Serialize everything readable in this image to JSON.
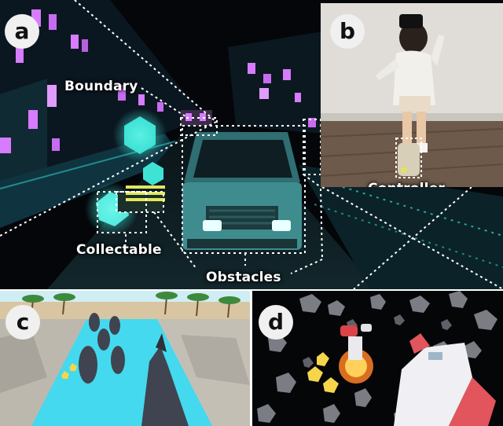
{
  "panels": [
    {
      "id": "a",
      "badge": "a"
    },
    {
      "id": "b",
      "badge": "b"
    },
    {
      "id": "c",
      "badge": "c"
    },
    {
      "id": "d",
      "badge": "d"
    }
  ],
  "labels": {
    "boundary": "Boundary",
    "collectable": "Collectable",
    "obstacles": "Obstacles",
    "controller": "Controller"
  },
  "colors": {
    "neon_purple": "#d77cff",
    "neon_teal": "#3fe3d6",
    "dotted_line": "#ffffff",
    "water": "#44d9ee",
    "sand": "#d8c6a3"
  }
}
